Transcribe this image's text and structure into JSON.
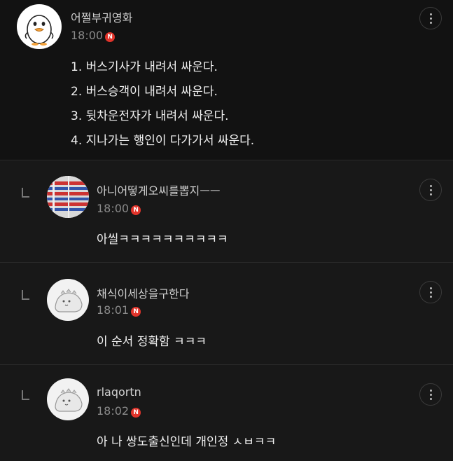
{
  "post": {
    "author": "어쩔부귀영화",
    "time": "18:00",
    "badge": "N",
    "lines": [
      "1. 버스기사가 내려서 싸운다.",
      "2. 버스승객이 내려서 싸운다.",
      "3. 뒷차운전자가 내려서 싸운다.",
      "4. 지나가는 행인이 다가가서 싸운다."
    ]
  },
  "replies": [
    {
      "author": "아니어떻게오씨를뽑지ㅡㅡ",
      "time": "18:00",
      "badge": "N",
      "text": "아씰ㅋㅋㅋㅋㅋㅋㅋㅋㅋㅋ"
    },
    {
      "author": "채식이세상을구한다",
      "time": "18:01",
      "badge": "N",
      "text": "이 순서 정확함 ㅋㅋㅋ"
    },
    {
      "author": "rlaqortn",
      "time": "18:02",
      "badge": "N",
      "text": "아 나 쌍도출신인데 개인정 ㅅㅂㅋㅋ"
    }
  ],
  "icons": {
    "more": "more-vertical-icon",
    "reply": "reply-arrow-icon",
    "badge_color": "#e2342b"
  }
}
